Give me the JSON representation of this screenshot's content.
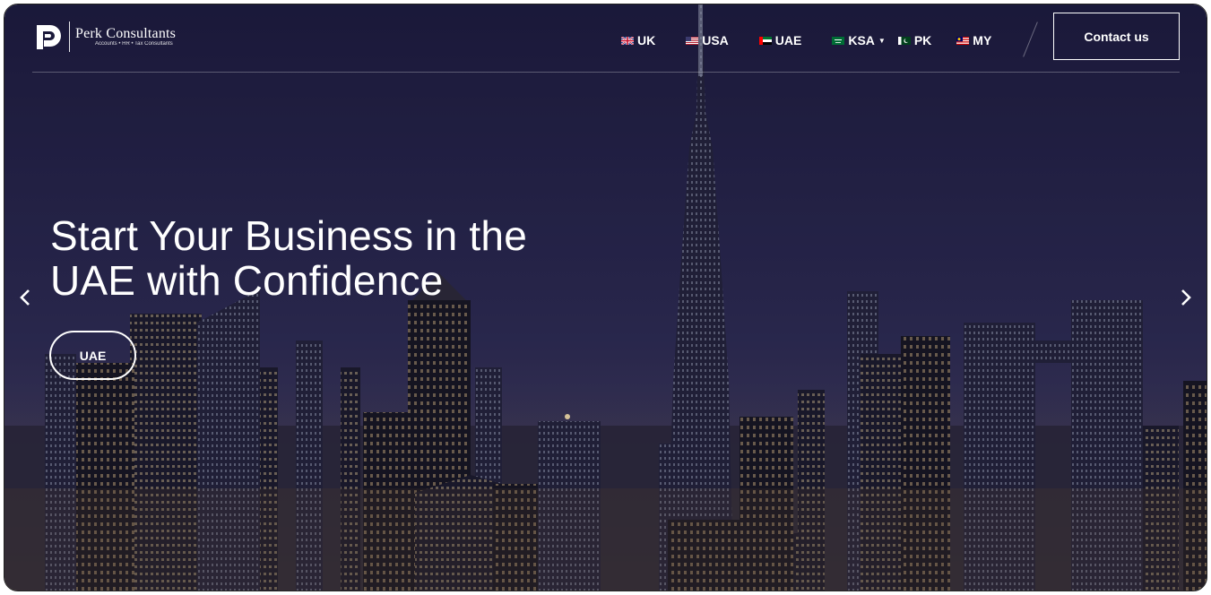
{
  "brand": {
    "name": "Perk Consultants",
    "tagline": "Accounts • HR • Tax Consultants"
  },
  "nav": {
    "items": [
      {
        "label": "UK",
        "icon": "uk-flag-icon"
      },
      {
        "label": "USA",
        "icon": "usa-flag-icon"
      },
      {
        "label": "UAE",
        "icon": "uae-flag-icon"
      },
      {
        "label": "KSA",
        "icon": "ksa-flag-icon",
        "has_dropdown": true
      },
      {
        "label": "PK",
        "icon": "pk-flag-icon"
      },
      {
        "label": "MY",
        "icon": "my-flag-icon"
      }
    ],
    "contact_label": "Contact us"
  },
  "hero": {
    "headline_line1": "Start Your Business in the",
    "headline_line2": "UAE with Confidence",
    "button_label": "UAE",
    "prev_icon": "chevron-left-icon",
    "next_icon": "chevron-right-icon"
  },
  "colors": {
    "sky_top": "#1d1c3f",
    "sky_bottom": "#3a3a63",
    "text": "#ffffff"
  }
}
